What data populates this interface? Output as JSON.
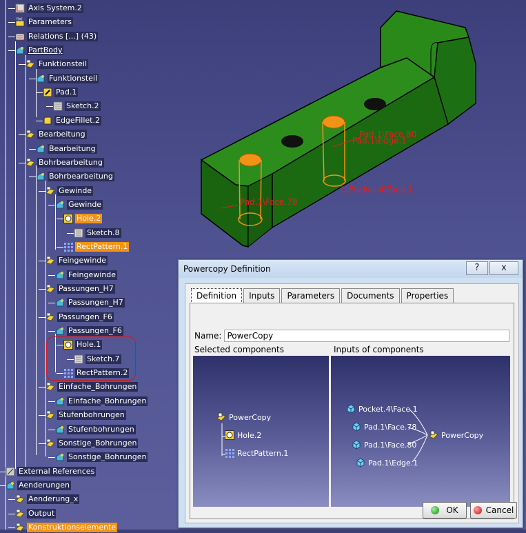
{
  "tree": {
    "nodes": [
      {
        "label": "Axis System.2",
        "icon": "axis-system-icon"
      },
      {
        "label": "Parameters",
        "icon": "parameters-icon"
      },
      {
        "label": "Relations [...] (43)",
        "icon": "relations-icon"
      },
      {
        "label": "PartBody",
        "icon": "body-icon"
      },
      {
        "label": "Funktionsteil",
        "icon": "folder-icon"
      },
      {
        "label": "Funktionsteil",
        "icon": "body-icon"
      },
      {
        "label": "Pad.1",
        "icon": "pad-icon"
      },
      {
        "label": "Sketch.2",
        "icon": "sketch-icon"
      },
      {
        "label": "EdgeFillet.2",
        "icon": "edge-fillet-icon"
      },
      {
        "label": "Bearbeitung",
        "icon": "folder-icon"
      },
      {
        "label": "Bearbeitung",
        "icon": "body-icon"
      },
      {
        "label": "Bohrbearbeitung",
        "icon": "folder-icon"
      },
      {
        "label": "Bohrbearbeitung",
        "icon": "body-icon"
      },
      {
        "label": "Gewinde",
        "icon": "folder-icon"
      },
      {
        "label": "Gewinde",
        "icon": "body-icon"
      },
      {
        "label": "Hole.2",
        "icon": "hole-icon"
      },
      {
        "label": "Sketch.8",
        "icon": "sketch-icon"
      },
      {
        "label": "RectPattern.1",
        "icon": "pattern-icon"
      },
      {
        "label": "Feingewinde",
        "icon": "folder-icon"
      },
      {
        "label": "Feingewinde",
        "icon": "body-icon"
      },
      {
        "label": "Passungen_H7",
        "icon": "folder-icon"
      },
      {
        "label": "Passungen_H7",
        "icon": "body-icon"
      },
      {
        "label": "Passungen_F6",
        "icon": "folder-icon"
      },
      {
        "label": "Passungen_F6",
        "icon": "body-icon"
      },
      {
        "label": "Hole.1",
        "icon": "hole-icon"
      },
      {
        "label": "Sketch.7",
        "icon": "sketch-icon"
      },
      {
        "label": "RectPattern.2",
        "icon": "pattern-icon"
      },
      {
        "label": "Einfache_Bohrungen",
        "icon": "folder-icon"
      },
      {
        "label": "Einfache_Bohrungen",
        "icon": "body-icon"
      },
      {
        "label": "Stufenbohrungen",
        "icon": "folder-icon"
      },
      {
        "label": "Stufenbohrungen",
        "icon": "body-icon"
      },
      {
        "label": "Sonstige_Bohrungen",
        "icon": "folder-icon"
      },
      {
        "label": "Sonstige_Bohrungen",
        "icon": "body-icon"
      },
      {
        "label": "External References",
        "icon": "external-references-icon"
      },
      {
        "label": "Aenderungen",
        "icon": "body-icon"
      },
      {
        "label": "Aenderung_x",
        "icon": "folder-icon"
      },
      {
        "label": "Output",
        "icon": "folder-icon"
      },
      {
        "label": "Konstruktionselemente",
        "icon": "folder-icon"
      }
    ]
  },
  "viewer": {
    "labels": [
      "Pad.1\\Face.80",
      "Pad.1\\Edge.1",
      "Pocket.4\\Face.1",
      "Pad.1\\Face.78"
    ],
    "part_color": "#1f7a13",
    "label_color": "#e02020",
    "highlight_color": "#f29318"
  },
  "dialog": {
    "title": "Powercopy Definition",
    "help_button": "?",
    "close_button": "x",
    "tabs": [
      "Definition",
      "Inputs",
      "Parameters",
      "Documents",
      "Properties"
    ],
    "name_label": "Name:",
    "name_value": "PowerCopy",
    "selected_label": "Selected components",
    "inputs_label": "Inputs of components",
    "selected_components": {
      "root": "PowerCopy",
      "children": [
        "Hole.2",
        "RectPattern.1"
      ]
    },
    "input_components": {
      "inputs": [
        "Pocket.4\\Face.1",
        "Pad.1\\Face.78",
        "Pad.1\\Face.80",
        "Pad.1\\Edge.1"
      ],
      "target": "PowerCopy"
    },
    "ok_label": "OK",
    "cancel_label": "Cancel"
  }
}
